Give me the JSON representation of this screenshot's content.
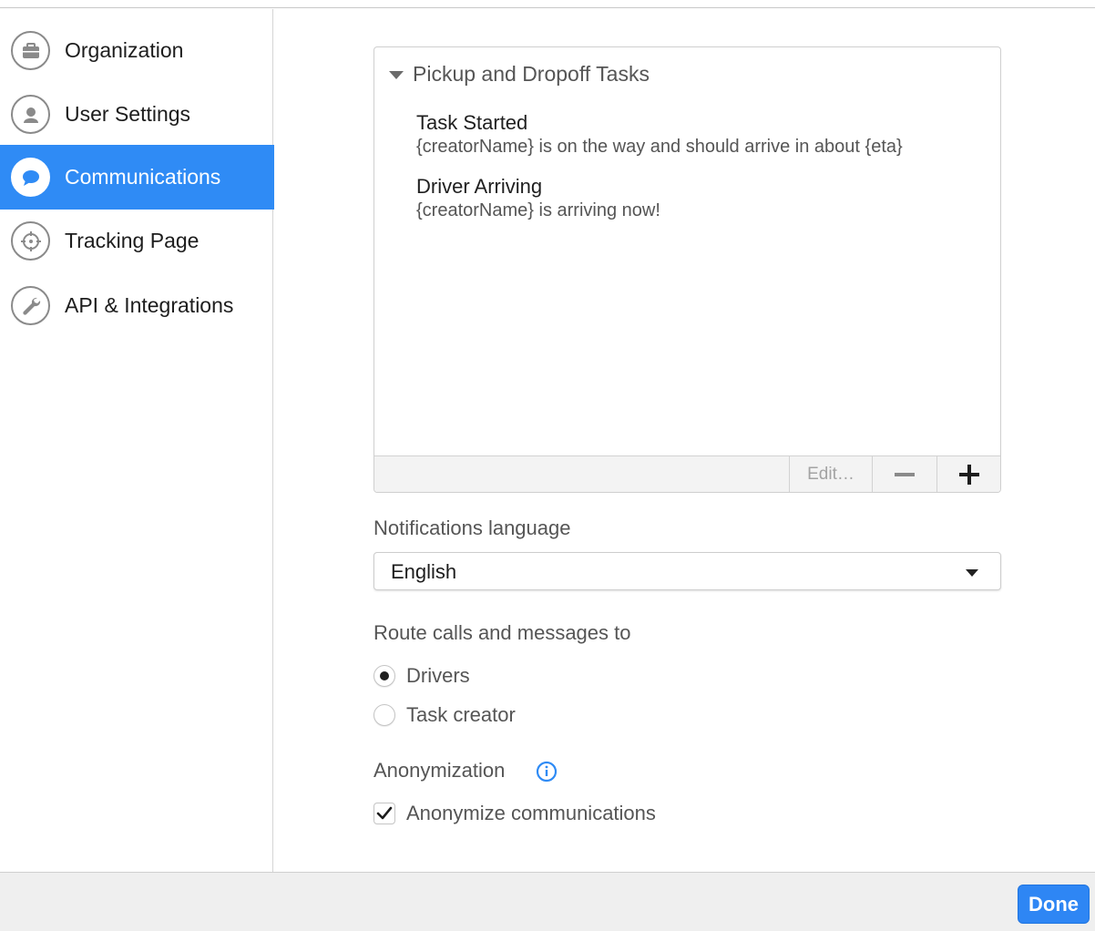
{
  "sidebar": {
    "items": [
      {
        "label": "Organization",
        "icon": "briefcase-icon",
        "active": false
      },
      {
        "label": "User Settings",
        "icon": "user-icon",
        "active": false
      },
      {
        "label": "Communications",
        "icon": "speech-bubble-icon",
        "active": true
      },
      {
        "label": "Tracking Page",
        "icon": "crosshair-icon",
        "active": false
      },
      {
        "label": "API & Integrations",
        "icon": "wrench-icon",
        "active": false
      }
    ]
  },
  "tasks_panel": {
    "title": "Pickup and Dropoff Tasks",
    "items": [
      {
        "name": "Task Started",
        "message": "{creatorName} is on the way and should arrive in about {eta}"
      },
      {
        "name": "Driver Arriving",
        "message": "{creatorName} is arriving now!"
      }
    ],
    "edit_label": "Edit…"
  },
  "language": {
    "label": "Notifications language",
    "selected": "English"
  },
  "routing": {
    "label": "Route calls and messages to",
    "options": [
      {
        "label": "Drivers",
        "selected": true
      },
      {
        "label": "Task creator",
        "selected": false
      }
    ]
  },
  "anonymization": {
    "label": "Anonymization",
    "checkbox_label": "Anonymize communications",
    "checked": true
  },
  "footer": {
    "done_label": "Done"
  },
  "colors": {
    "accent": "#2f8bf5",
    "done_button": "#2e86f4"
  }
}
